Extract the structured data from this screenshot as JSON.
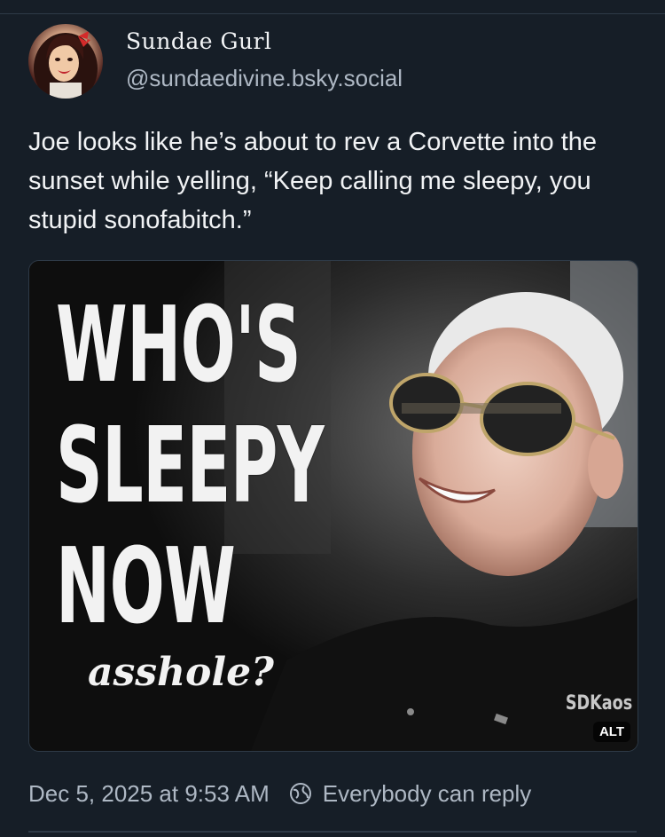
{
  "author": {
    "display_name": "Sundae Gurl",
    "handle": "@sundaedivine.bsky.social",
    "avatar_icon": "avatar-woman-red-bow"
  },
  "post": {
    "text": "Joe looks like he’s about to rev a Corvette into the sunset while yelling, “Keep calling me sleepy, you stupid sonofabitch.”",
    "image": {
      "line1": "WHO'S",
      "line2": "SLEEPY",
      "line3": "NOW",
      "line4": "asshole?",
      "watermark": "SDKaos",
      "alt_label": "ALT"
    }
  },
  "footer": {
    "timestamp": "Dec 5, 2025 at 9:53 AM",
    "reply_setting": "Everybody can reply",
    "reply_icon": "globe-icon"
  },
  "colors": {
    "background": "#161e27",
    "text": "#f1f3f5",
    "muted": "#aeb8c4",
    "divider": "#2e3a47"
  }
}
